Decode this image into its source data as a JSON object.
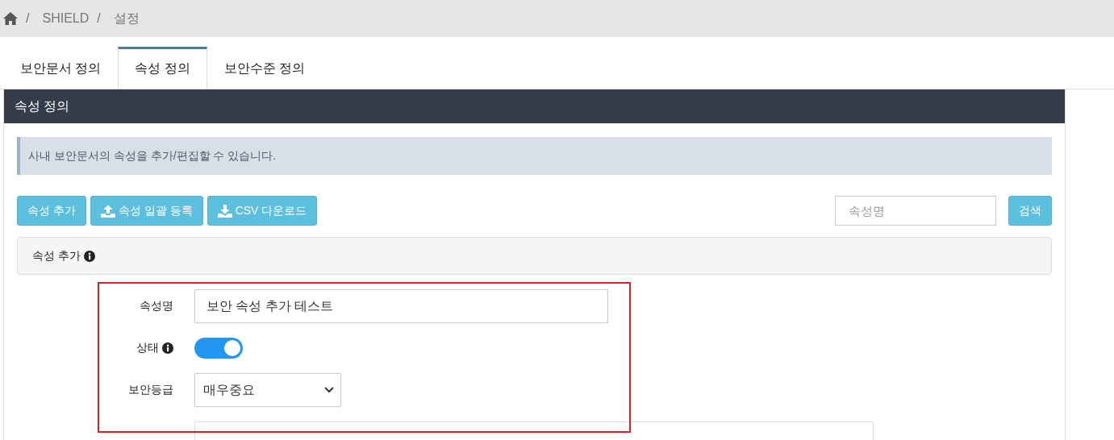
{
  "breadcrumb": [
    {
      "kind": "home"
    },
    {
      "kind": "separator",
      "text": "/"
    },
    {
      "kind": "link",
      "text": "SHIELD"
    },
    {
      "kind": "separator",
      "text": "/"
    },
    {
      "kind": "current",
      "text": "설정"
    }
  ],
  "tabs": [
    {
      "label": "보안문서 정의",
      "selected": false
    },
    {
      "label": "속성 정의",
      "selected": true
    },
    {
      "label": "보안수준 정의",
      "selected": false
    }
  ],
  "panel": {
    "title": "속성 정의",
    "notice": "사내 보안문서의 속성을 추가/편집할 수 있습니다.",
    "buttons": [
      {
        "label": "속성 추가",
        "kind": "plain"
      },
      {
        "label": "속성 일괄 등록",
        "kind": "upload"
      },
      {
        "label": "CSV 다운로드",
        "kind": "download"
      }
    ],
    "search": {
      "placeholder": "속성명"
    },
    "search_button": "검색",
    "section": {
      "title": "속성 추가",
      "info": true
    },
    "form": {
      "highlighted": true,
      "fields": [
        {
          "kind": "text",
          "label": "속성명",
          "value": "보안 속성 추가 테스트"
        },
        {
          "kind": "toggle",
          "label": "상태",
          "info": true,
          "on": true
        },
        {
          "kind": "select",
          "label": "보안등급",
          "value": "매우중요"
        },
        {
          "kind": "wide"
        }
      ]
    }
  }
}
